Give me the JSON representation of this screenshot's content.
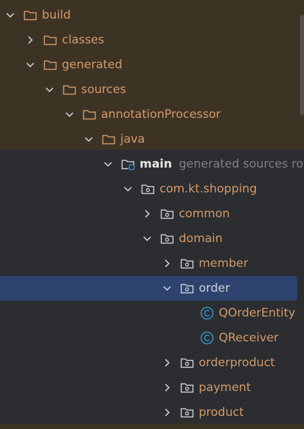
{
  "colors": {
    "excluded_background": "#3d3325",
    "panel_background": "#2b2d30",
    "selection": "#2e436e",
    "folder_label": "#d49a6a",
    "class_icon": "#3592c4"
  },
  "tree": [
    {
      "label": "build",
      "expanded": true,
      "icon": "folder-icon"
    },
    {
      "label": "classes",
      "expanded": false,
      "icon": "folder-icon"
    },
    {
      "label": "generated",
      "expanded": true,
      "icon": "folder-icon"
    },
    {
      "label": "sources",
      "expanded": true,
      "icon": "folder-icon"
    },
    {
      "label": "annotationProcessor",
      "expanded": true,
      "icon": "folder-icon"
    },
    {
      "label": "java",
      "expanded": true,
      "icon": "folder-icon"
    },
    {
      "label": "main",
      "hint": "generated sources roo",
      "expanded": true,
      "icon": "source-root-icon"
    },
    {
      "label": "com.kt.shopping",
      "expanded": true,
      "icon": "package-icon"
    },
    {
      "label": "common",
      "expanded": false,
      "icon": "package-icon"
    },
    {
      "label": "domain",
      "expanded": true,
      "icon": "package-icon"
    },
    {
      "label": "member",
      "expanded": false,
      "icon": "package-icon"
    },
    {
      "label": "order",
      "expanded": true,
      "icon": "package-icon",
      "selected": true
    },
    {
      "label": "QOrderEntity",
      "icon": "class-icon"
    },
    {
      "label": "QReceiver",
      "icon": "class-icon"
    },
    {
      "label": "orderproduct",
      "expanded": false,
      "icon": "package-icon"
    },
    {
      "label": "payment",
      "expanded": false,
      "icon": "package-icon"
    },
    {
      "label": "product",
      "expanded": false,
      "icon": "package-icon"
    }
  ]
}
